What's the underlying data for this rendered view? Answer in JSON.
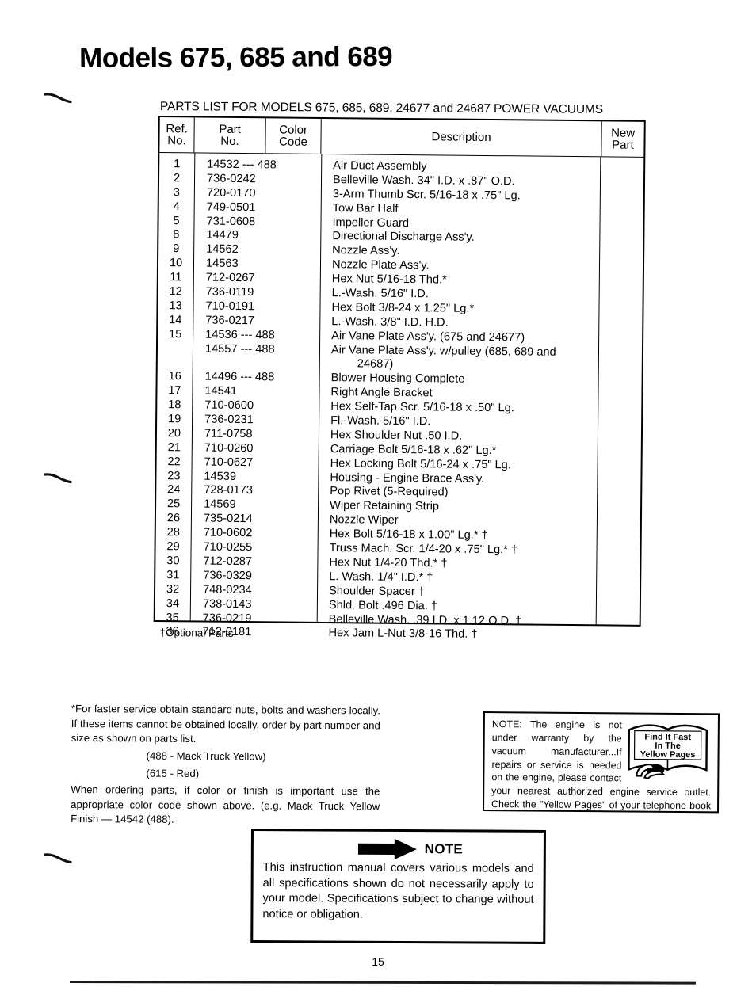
{
  "document": {
    "title": "Models 675, 685 and 689",
    "page_number": "15"
  },
  "parts_table": {
    "caption": "PARTS LIST FOR MODELS 675, 685, 689, 24677 and 24687 POWER VACUUMS",
    "columns": {
      "ref_no_line1": "Ref.",
      "ref_no_line2": "No.",
      "part_no_line1": "Part",
      "part_no_line2": "No.",
      "color_code_line1": "Color",
      "color_code_line2": "Code",
      "description": "Description",
      "new_part_line1": "New",
      "new_part_line2": "Part"
    },
    "rows": [
      {
        "ref": "1",
        "part": "14532 --- 488",
        "desc": "Air Duct Assembly",
        "new": ""
      },
      {
        "ref": "2",
        "part": "736-0242",
        "desc": "Belleville Wash. 34\" I.D. x .87\" O.D.",
        "new": ""
      },
      {
        "ref": "3",
        "part": "720-0170",
        "desc": "3-Arm Thumb Scr. 5/16-18 x .75\" Lg.",
        "new": ""
      },
      {
        "ref": "4",
        "part": "749-0501",
        "desc": "Tow Bar Half",
        "new": ""
      },
      {
        "ref": "5",
        "part": "731-0608",
        "desc": "Impeller  Guard",
        "new": ""
      },
      {
        "ref": "8",
        "part": "14479",
        "desc": "Directional Discharge Ass'y.",
        "new": ""
      },
      {
        "ref": "9",
        "part": "14562",
        "desc": "Nozzle Ass'y.",
        "new": ""
      },
      {
        "ref": "10",
        "part": "14563",
        "desc": "Nozzle Plate Ass'y.",
        "new": ""
      },
      {
        "ref": "11",
        "part": "712-0267",
        "desc": "Hex Nut 5/16-18 Thd.*",
        "new": ""
      },
      {
        "ref": "12",
        "part": "736-0119",
        "desc": "L.-Wash. 5/16\" I.D.",
        "new": ""
      },
      {
        "ref": "13",
        "part": "710-0191",
        "desc": "Hex Bolt 3/8-24 x 1.25\" Lg.*",
        "new": ""
      },
      {
        "ref": "14",
        "part": "736-0217",
        "desc": "L.-Wash. 3/8\" I.D. H.D.",
        "new": ""
      },
      {
        "ref": "15",
        "part": "14536 --- 488",
        "desc": "Air Vane Plate Ass'y. (675 and 24677)",
        "new": ""
      },
      {
        "ref": "",
        "part": "14557 --- 488",
        "desc": "Air Vane Plate Ass'y. w/pulley (685, 689 and",
        "new": ""
      },
      {
        "ref": "",
        "part": "",
        "desc": "24687)",
        "new": "",
        "continuation": true
      },
      {
        "ref": "16",
        "part": "14496 --- 488",
        "desc": "Blower Housing Complete",
        "new": ""
      },
      {
        "ref": "17",
        "part": "14541",
        "desc": "Right Angle Bracket",
        "new": ""
      },
      {
        "ref": "18",
        "part": "710-0600",
        "desc": "Hex Self-Tap Scr. 5/16-18 x .50\" Lg.",
        "new": ""
      },
      {
        "ref": "19",
        "part": "736-0231",
        "desc": "Fl.-Wash. 5/16\" I.D.",
        "new": ""
      },
      {
        "ref": "20",
        "part": "711-0758",
        "desc": "Hex Shoulder Nut .50 I.D.",
        "new": ""
      },
      {
        "ref": "21",
        "part": "710-0260",
        "desc": "Carriage Bolt 5/16-18 x .62\" Lg.*",
        "new": ""
      },
      {
        "ref": "22",
        "part": "710-0627",
        "desc": "Hex Locking Bolt 5/16-24 x .75\" Lg.",
        "new": ""
      },
      {
        "ref": "23",
        "part": "14539",
        "desc": "Housing - Engine Brace Ass'y.",
        "new": ""
      },
      {
        "ref": "24",
        "part": "728-0173",
        "desc": "Pop Rivet (5-Required)",
        "new": ""
      },
      {
        "ref": "25",
        "part": "14569",
        "desc": "Wiper Retaining Strip",
        "new": ""
      },
      {
        "ref": "26",
        "part": "735-0214",
        "desc": "Nozzle Wiper",
        "new": ""
      },
      {
        "ref": "28",
        "part": "710-0602",
        "desc": "Hex Bolt 5/16-18 x 1.00\" Lg.* †",
        "new": ""
      },
      {
        "ref": "29",
        "part": "710-0255",
        "desc": "Truss Mach. Scr. 1/4-20 x .75\" Lg.* †",
        "new": ""
      },
      {
        "ref": "30",
        "part": "712-0287",
        "desc": "Hex Nut 1/4-20 Thd.* †",
        "new": ""
      },
      {
        "ref": "31",
        "part": "736-0329",
        "desc": "L. Wash. 1/4\" I.D.* †",
        "new": ""
      },
      {
        "ref": "32",
        "part": "748-0234",
        "desc": "Shoulder Spacer †",
        "new": ""
      },
      {
        "ref": "34",
        "part": "738-0143",
        "desc": "Shld. Bolt .496 Dia. †",
        "new": ""
      },
      {
        "ref": "35",
        "part": "736-0219",
        "desc": "Belleville Wash. .39 I.D. x 1.12 O.D. †",
        "new": ""
      },
      {
        "ref": "36",
        "part": "712-0181",
        "desc": "Hex Jam L-Nut 3/8-16 Thd. †",
        "new": ""
      }
    ],
    "footnote": "†Optional Parts"
  },
  "ordering_note": {
    "paragraph1": "*For faster service obtain standard nuts, bolts and washers locally. If these items cannot be obtained locally, order by part number and size as shown on parts list.",
    "color_code_1": "(488 - Mack Truck Yellow)",
    "color_code_2": "(615 -  Red)",
    "paragraph2": "When ordering parts, if color or finish is important use the appropriate color code shown above. (e.g. Mack  Truck  Yellow Finish — 14542 (488)."
  },
  "warranty_note": {
    "text": "NOTE: The engine is not under warranty by the vacuum manufacturer...If repairs or service is needed on the engine, please contact your nearest authorized engine service outlet. Check the \"Yellow Pages\" of your telephone book under \"Engines—Gasoline.\"",
    "figure": {
      "line1": "Find It Fast",
      "line2": "In The",
      "line3": "Yellow Pages"
    }
  },
  "manual_note": {
    "label": "NOTE",
    "body": "This instruction manual covers various models and all specifications shown do not necessarily apply to your model. Specifications subject to change without notice or obligation."
  }
}
